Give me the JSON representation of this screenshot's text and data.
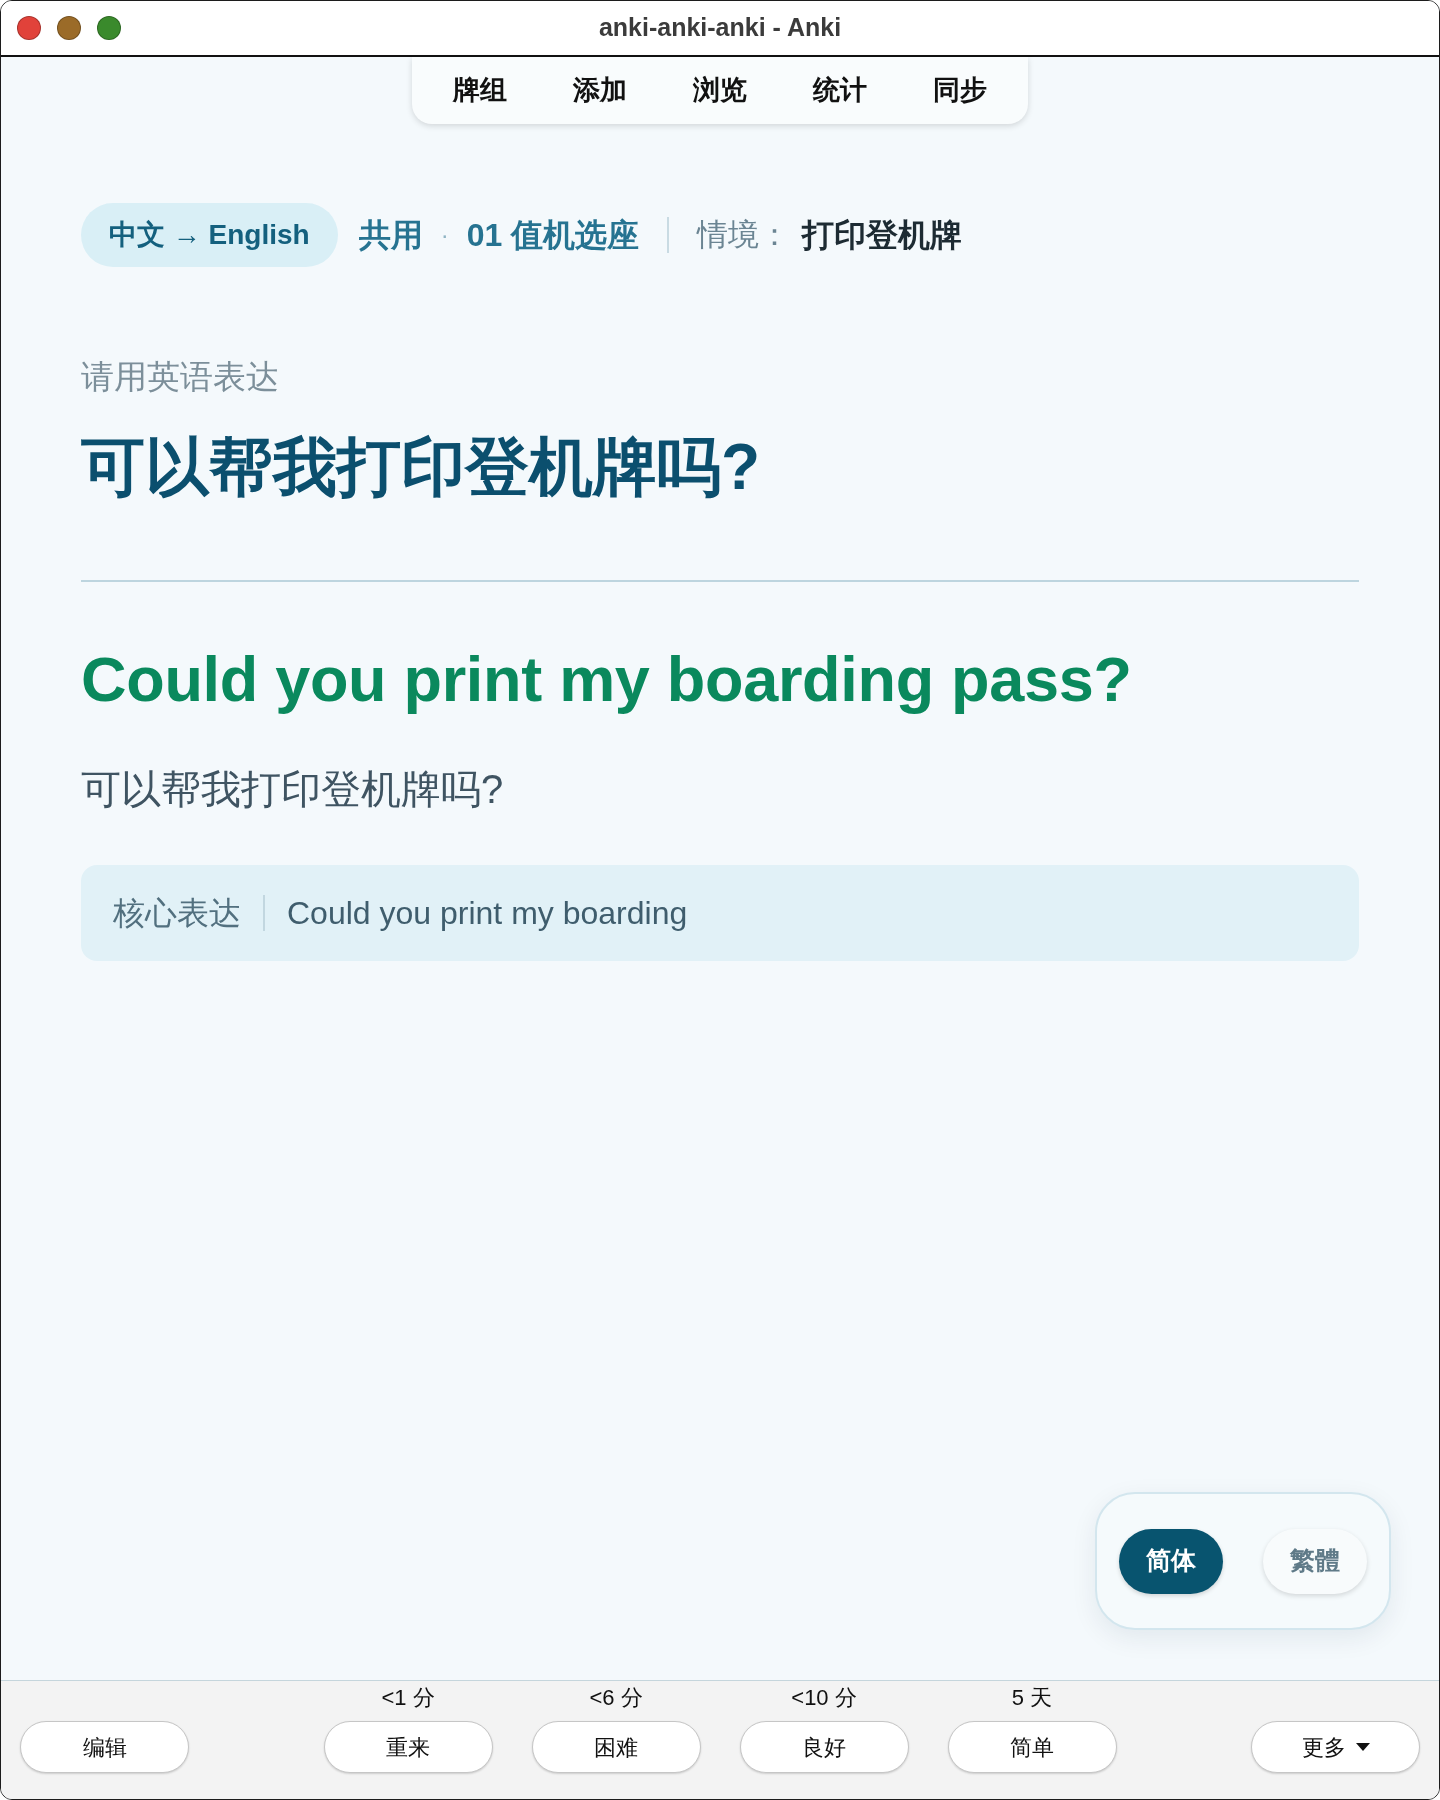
{
  "window": {
    "title": "anki-anki-anki - Anki"
  },
  "top_nav": [
    "牌组",
    "添加",
    "浏览",
    "统计",
    "同步"
  ],
  "breadcrumb": {
    "direction": "中文 → English",
    "category": "共用",
    "separator": "·",
    "lesson": "01 值机选座",
    "context_label": "情境：",
    "context": "打印登机牌"
  },
  "card": {
    "prompt": "请用英语表达",
    "question": "可以帮我打印登机牌吗?",
    "answer": "Could you print my boarding pass?",
    "translation": "可以帮我打印登机牌吗?",
    "core_expression": {
      "label": "核心表达",
      "text": "Could you print my boarding"
    }
  },
  "script_toggle": [
    {
      "label": "简体",
      "selected": true
    },
    {
      "label": "繁體",
      "selected": false
    }
  ],
  "bottom_bar": {
    "edit_button": "编辑",
    "answer_buttons": [
      {
        "interval": "<1 分",
        "label": "重来"
      },
      {
        "interval": "<6 分",
        "label": "困难"
      },
      {
        "interval": "<10 分",
        "label": "良好"
      },
      {
        "interval": "5 天",
        "label": "简单"
      }
    ],
    "more_button": "更多"
  }
}
